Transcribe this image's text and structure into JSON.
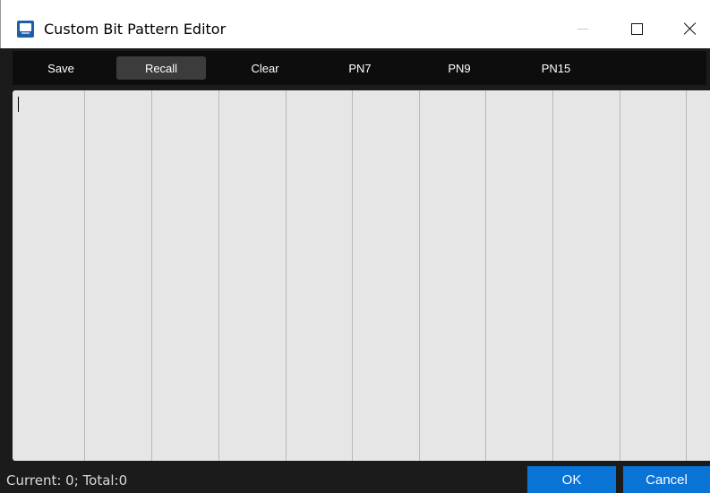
{
  "window": {
    "title": "Custom Bit Pattern Editor",
    "icon": "app-logo-icon"
  },
  "window_controls": {
    "minimize_icon": "minimize-icon",
    "maximize_icon": "maximize-icon",
    "close_icon": "close-icon"
  },
  "toolbar": {
    "buttons": [
      {
        "label": "Save"
      },
      {
        "label": "Recall"
      },
      {
        "label": "Clear"
      },
      {
        "label": "PN7"
      },
      {
        "label": "PN9"
      },
      {
        "label": "PN15"
      }
    ],
    "active": "Recall"
  },
  "editor": {
    "value": ""
  },
  "status": {
    "text": "Current: 0; Total:0"
  },
  "footer": {
    "ok_label": "OK",
    "cancel_label": "Cancel"
  },
  "colors": {
    "accent": "#0a73d6",
    "background": "#1b1b1b",
    "editor_bg": "#e6e6e6"
  }
}
